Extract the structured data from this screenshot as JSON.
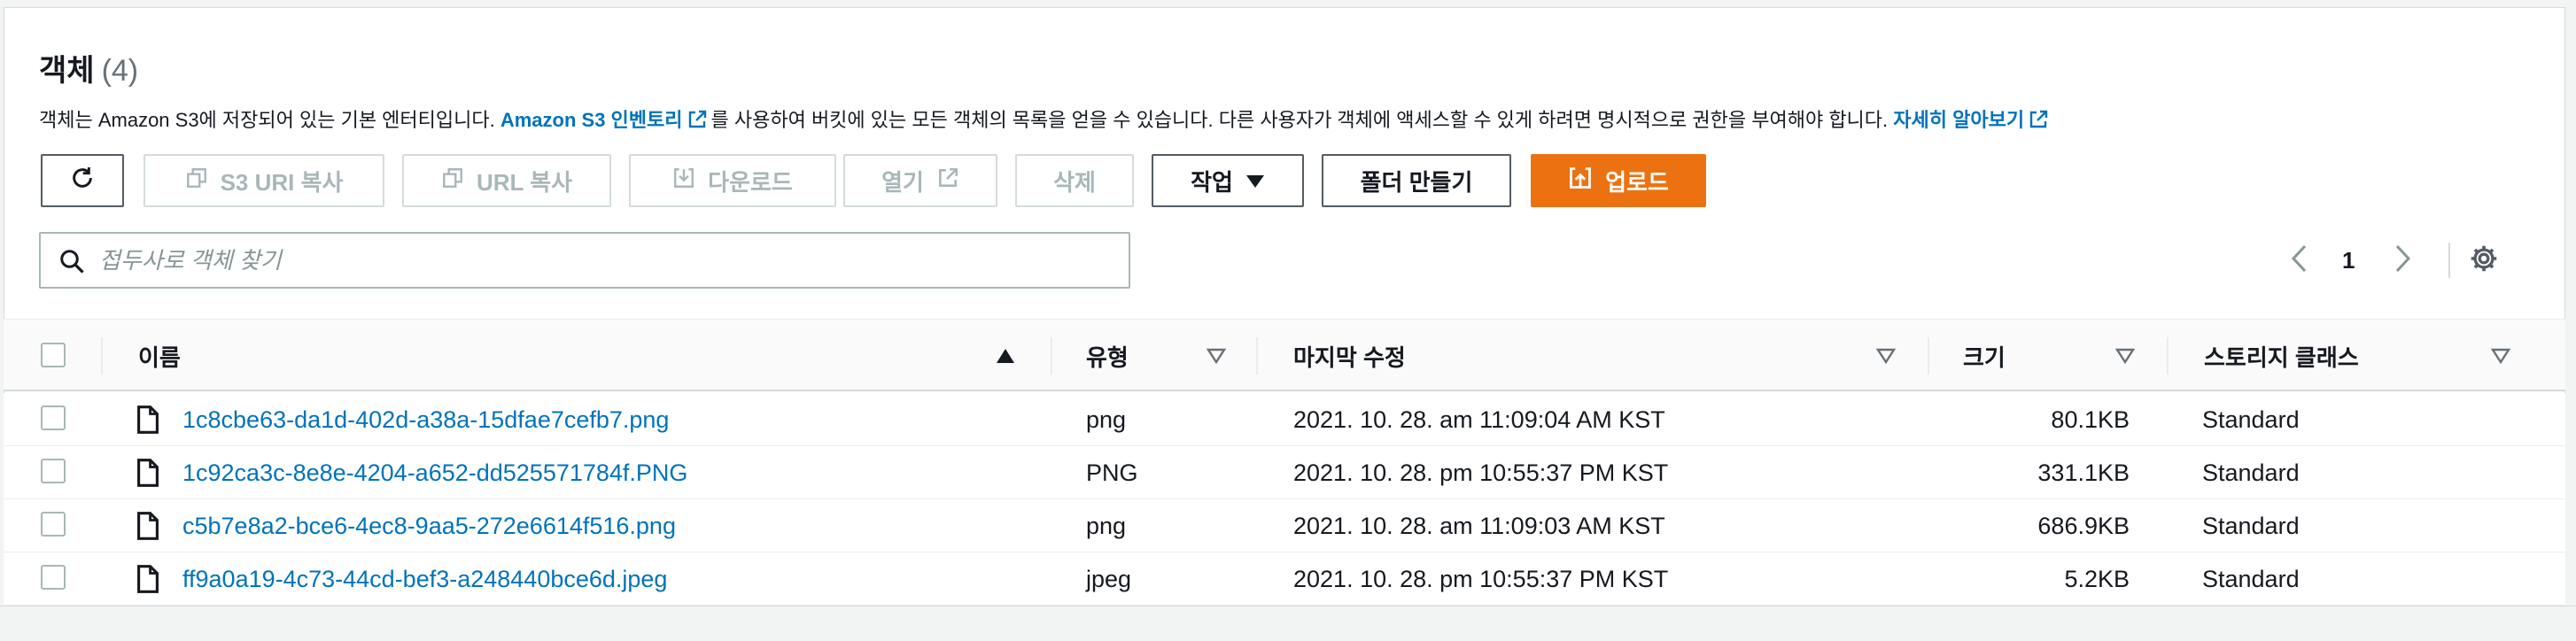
{
  "header": {
    "title": "객체",
    "count": "(4)"
  },
  "description": {
    "part1": "객체는 Amazon S3에 저장되어 있는 기본 엔터티입니다.",
    "link1": "Amazon S3 인벤토리",
    "part2": "를 사용하여 버킷에 있는 모든 객체의 목록을 얻을 수 있습니다. 다른 사용자가 객체에 액세스할 수 있게 하려면 명시적으로 권한을 부여해야 합니다.",
    "link2": "자세히 알아보기"
  },
  "toolbar": {
    "copy_s3_uri": "S3 URI 복사",
    "copy_url": "URL 복사",
    "download": "다운로드",
    "open": "열기",
    "delete": "삭제",
    "actions": "작업",
    "create_folder": "폴더 만들기",
    "upload": "업로드"
  },
  "search": {
    "placeholder": "접두사로 객체 찾기",
    "value": ""
  },
  "pagination": {
    "page": "1"
  },
  "table": {
    "columns": {
      "name": "이름",
      "type": "유형",
      "modified": "마지막 수정",
      "size": "크기",
      "storage_class": "스토리지 클래스"
    },
    "rows": [
      {
        "name": "1c8cbe63-da1d-402d-a38a-15dfae7cefb7.png",
        "type": "png",
        "modified": "2021. 10. 28. am 11:09:04 AM KST",
        "size": "80.1KB",
        "storage_class": "Standard"
      },
      {
        "name": "1c92ca3c-8e8e-4204-a652-dd525571784f.PNG",
        "type": "PNG",
        "modified": "2021. 10. 28. pm 10:55:37 PM KST",
        "size": "331.1KB",
        "storage_class": "Standard"
      },
      {
        "name": "c5b7e8a2-bce6-4ec8-9aa5-272e6614f516.png",
        "type": "png",
        "modified": "2021. 10. 28. am 11:09:03 AM KST",
        "size": "686.9KB",
        "storage_class": "Standard"
      },
      {
        "name": "ff9a0a19-4c73-44cd-bef3-a248440bce6d.jpeg",
        "type": "jpeg",
        "modified": "2021. 10. 28. pm 10:55:37 PM KST",
        "size": "5.2KB",
        "storage_class": "Standard"
      }
    ]
  },
  "colors": {
    "link": "#0073bb",
    "primary": "#ec7211",
    "text": "#16191f",
    "disabled": "#aab7b8"
  },
  "icons": {
    "refresh": "refresh-icon",
    "copy": "copy-icon",
    "download": "download-icon",
    "external": "external-link-icon",
    "caret": "caret-down-icon",
    "upload": "upload-icon",
    "search": "search-icon",
    "prev": "chevron-left-icon",
    "next": "chevron-right-icon",
    "settings": "gear-icon",
    "file": "file-icon"
  }
}
